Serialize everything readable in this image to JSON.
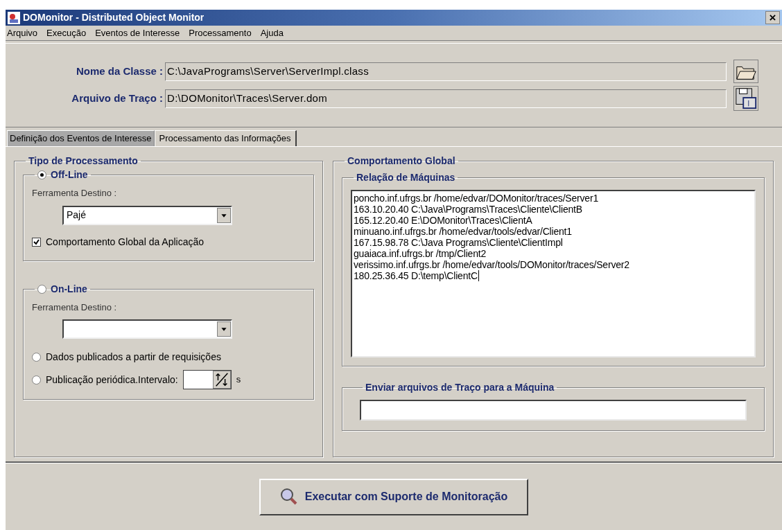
{
  "window": {
    "title": "DOMonitor - Distributed Object Monitor",
    "close": "×"
  },
  "menu": [
    "Arquivo",
    "Execução",
    "Eventos de Interesse",
    "Processamento",
    "Ajuda"
  ],
  "fields": [
    {
      "kind": "open",
      "label": "Nome da Classe :",
      "value": "C:\\JavaPrograms\\Server\\ServerImpl.class"
    },
    {
      "kind": "save",
      "label": "Arquivo de Traço :",
      "value": "D:\\DOMonitor\\Traces\\Server.dom"
    }
  ],
  "tabs": [
    {
      "label": "Definição dos Eventos de Interesse",
      "selected": false
    },
    {
      "label": "Processamento das Informações",
      "selected": true
    }
  ],
  "processing": {
    "title": "Tipo de Processamento",
    "offline": {
      "label": "Off-Line",
      "selected": true,
      "tool_label": "Ferramenta Destino :",
      "tool_value": "Pajé",
      "checkbox": {
        "label": "Comportamento Global da Aplicação",
        "checked": true
      }
    },
    "online": {
      "label": "On-Line",
      "selected": false,
      "tool_label": "Ferramenta Destino :",
      "options": [
        {
          "label": "Dados publicados a partir de requisições",
          "selected": false
        },
        {
          "label": "Publicação periódica.Intervalo:",
          "selected": false
        }
      ],
      "unit": "s"
    }
  },
  "global": {
    "title": "Comportamento Global",
    "machines": {
      "title": "Relação de Máquinas",
      "lines": [
        "poncho.inf.ufrgs.br /home/edvar/DOMonitor/traces/Server1",
        "163.10.20.40 C:\\Java\\Programs\\Traces\\Cliente\\ClientB",
        "165.12.20.40 E:\\DOMonitor\\Traces\\ClientA",
        "minuano.inf.ufrgs.br /home/edvar/tools/edvar/Client1",
        "167.15.98.78 C:\\Java Programs\\Cliente\\ClientImpl",
        "guaiaca.inf.ufrgs.br /tmp/Client2",
        "verissimo.inf.ufrgs.br /home/edvar/tools/DOMonitor/traces/Server2",
        "180.25.36.45 D:\\temp\\ClientC"
      ]
    },
    "send": {
      "title": "Enviar arquivos de Traço para a Máquina"
    }
  },
  "execute_button": "Executar com Suporte de Monitoração"
}
